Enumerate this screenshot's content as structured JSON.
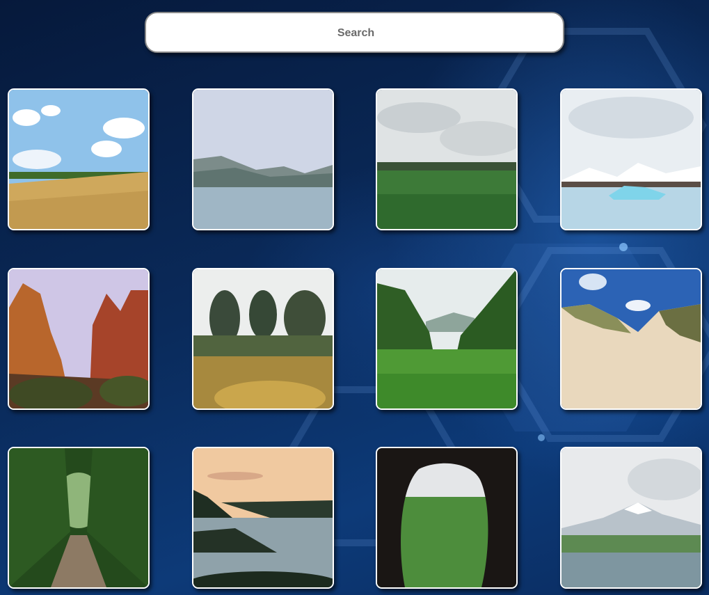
{
  "search": {
    "placeholder": "Search",
    "value": ""
  },
  "gallery": {
    "tiles": [
      {
        "name": "tile-wheat-field"
      },
      {
        "name": "tile-mountain-lake"
      },
      {
        "name": "tile-green-meadow"
      },
      {
        "name": "tile-glacier-lagoon"
      },
      {
        "name": "tile-red-rock-canyon"
      },
      {
        "name": "tile-forest-garden"
      },
      {
        "name": "tile-jungle-valley"
      },
      {
        "name": "tile-sand-dunes"
      },
      {
        "name": "tile-forest-path"
      },
      {
        "name": "tile-coastal-cliffs"
      },
      {
        "name": "tile-cave-view"
      },
      {
        "name": "tile-snowy-mountain-field"
      }
    ]
  }
}
